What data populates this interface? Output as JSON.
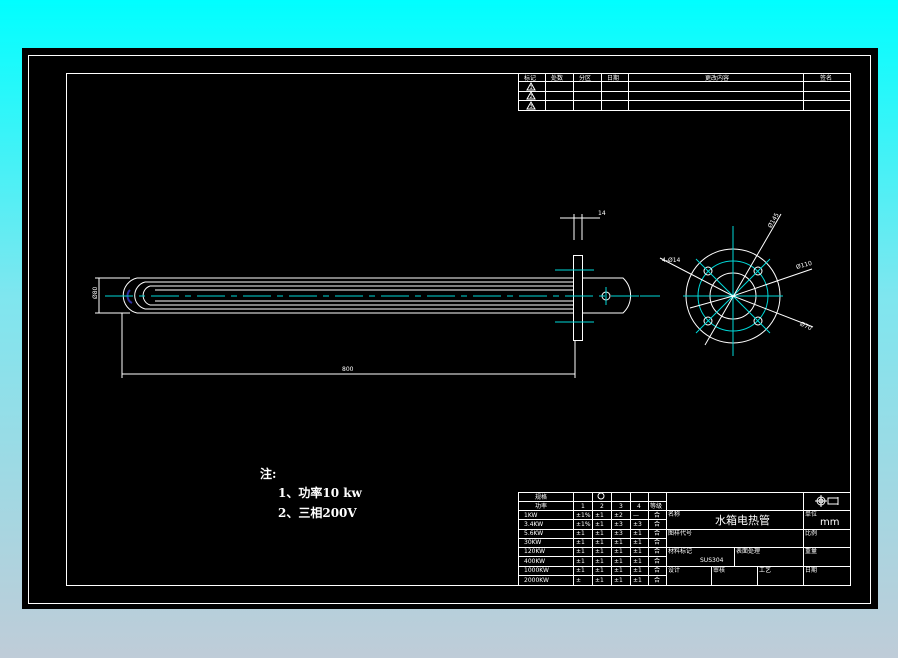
{
  "revision_table": {
    "headers": [
      "标记",
      "处数",
      "分区",
      "日期",
      "更改内容",
      "签名"
    ],
    "marks": [
      "1",
      "2",
      "3"
    ]
  },
  "dimensions": {
    "length": "800",
    "diameter": "Ø80",
    "flange_thickness": "14",
    "holes": "4-Ø14",
    "d1": "Ø145",
    "d2": "Ø110",
    "d3": "Ø70"
  },
  "notes": {
    "title": "注:",
    "items": [
      "1、功率10 kw",
      "2、三相200V"
    ]
  },
  "spec_table": {
    "header1": "规格",
    "header2": "功率",
    "rows": [
      [
        "1KW",
        "±1%",
        "±1",
        "±2",
        "—",
        "合"
      ],
      [
        "3.4KW",
        "±1%",
        "±1",
        "±3",
        "±3",
        "合"
      ],
      [
        "5.6KW",
        "±1",
        "±1",
        "±3",
        "±1",
        "合"
      ],
      [
        "30KW",
        "±1",
        "±1",
        "±1",
        "±1",
        "合"
      ],
      [
        "120KW",
        "±1",
        "±1",
        "±1",
        "±1",
        "合"
      ],
      [
        "400KW",
        "±1",
        "±1",
        "±1",
        "±1",
        "合"
      ],
      [
        "1000KW",
        "±1",
        "±1",
        "±1",
        "±1",
        "合"
      ],
      [
        "2000KW",
        "±",
        "±1",
        "±1",
        "±1",
        "合"
      ]
    ],
    "cols": [
      "1",
      "2",
      "3",
      "4",
      "等级"
    ]
  },
  "title_block": {
    "name_label": "名称",
    "name": "水箱电热管",
    "unit_label": "单位",
    "unit": "mm",
    "code_label": "图样代号",
    "scale_label": "比例",
    "material_label": "材料标记",
    "material": "SUS304",
    "treatment_label": "表面处理",
    "weight_label": "重量",
    "design_label": "设计",
    "check_label": "审核",
    "approve_label": "工艺",
    "date_label": "日期"
  }
}
